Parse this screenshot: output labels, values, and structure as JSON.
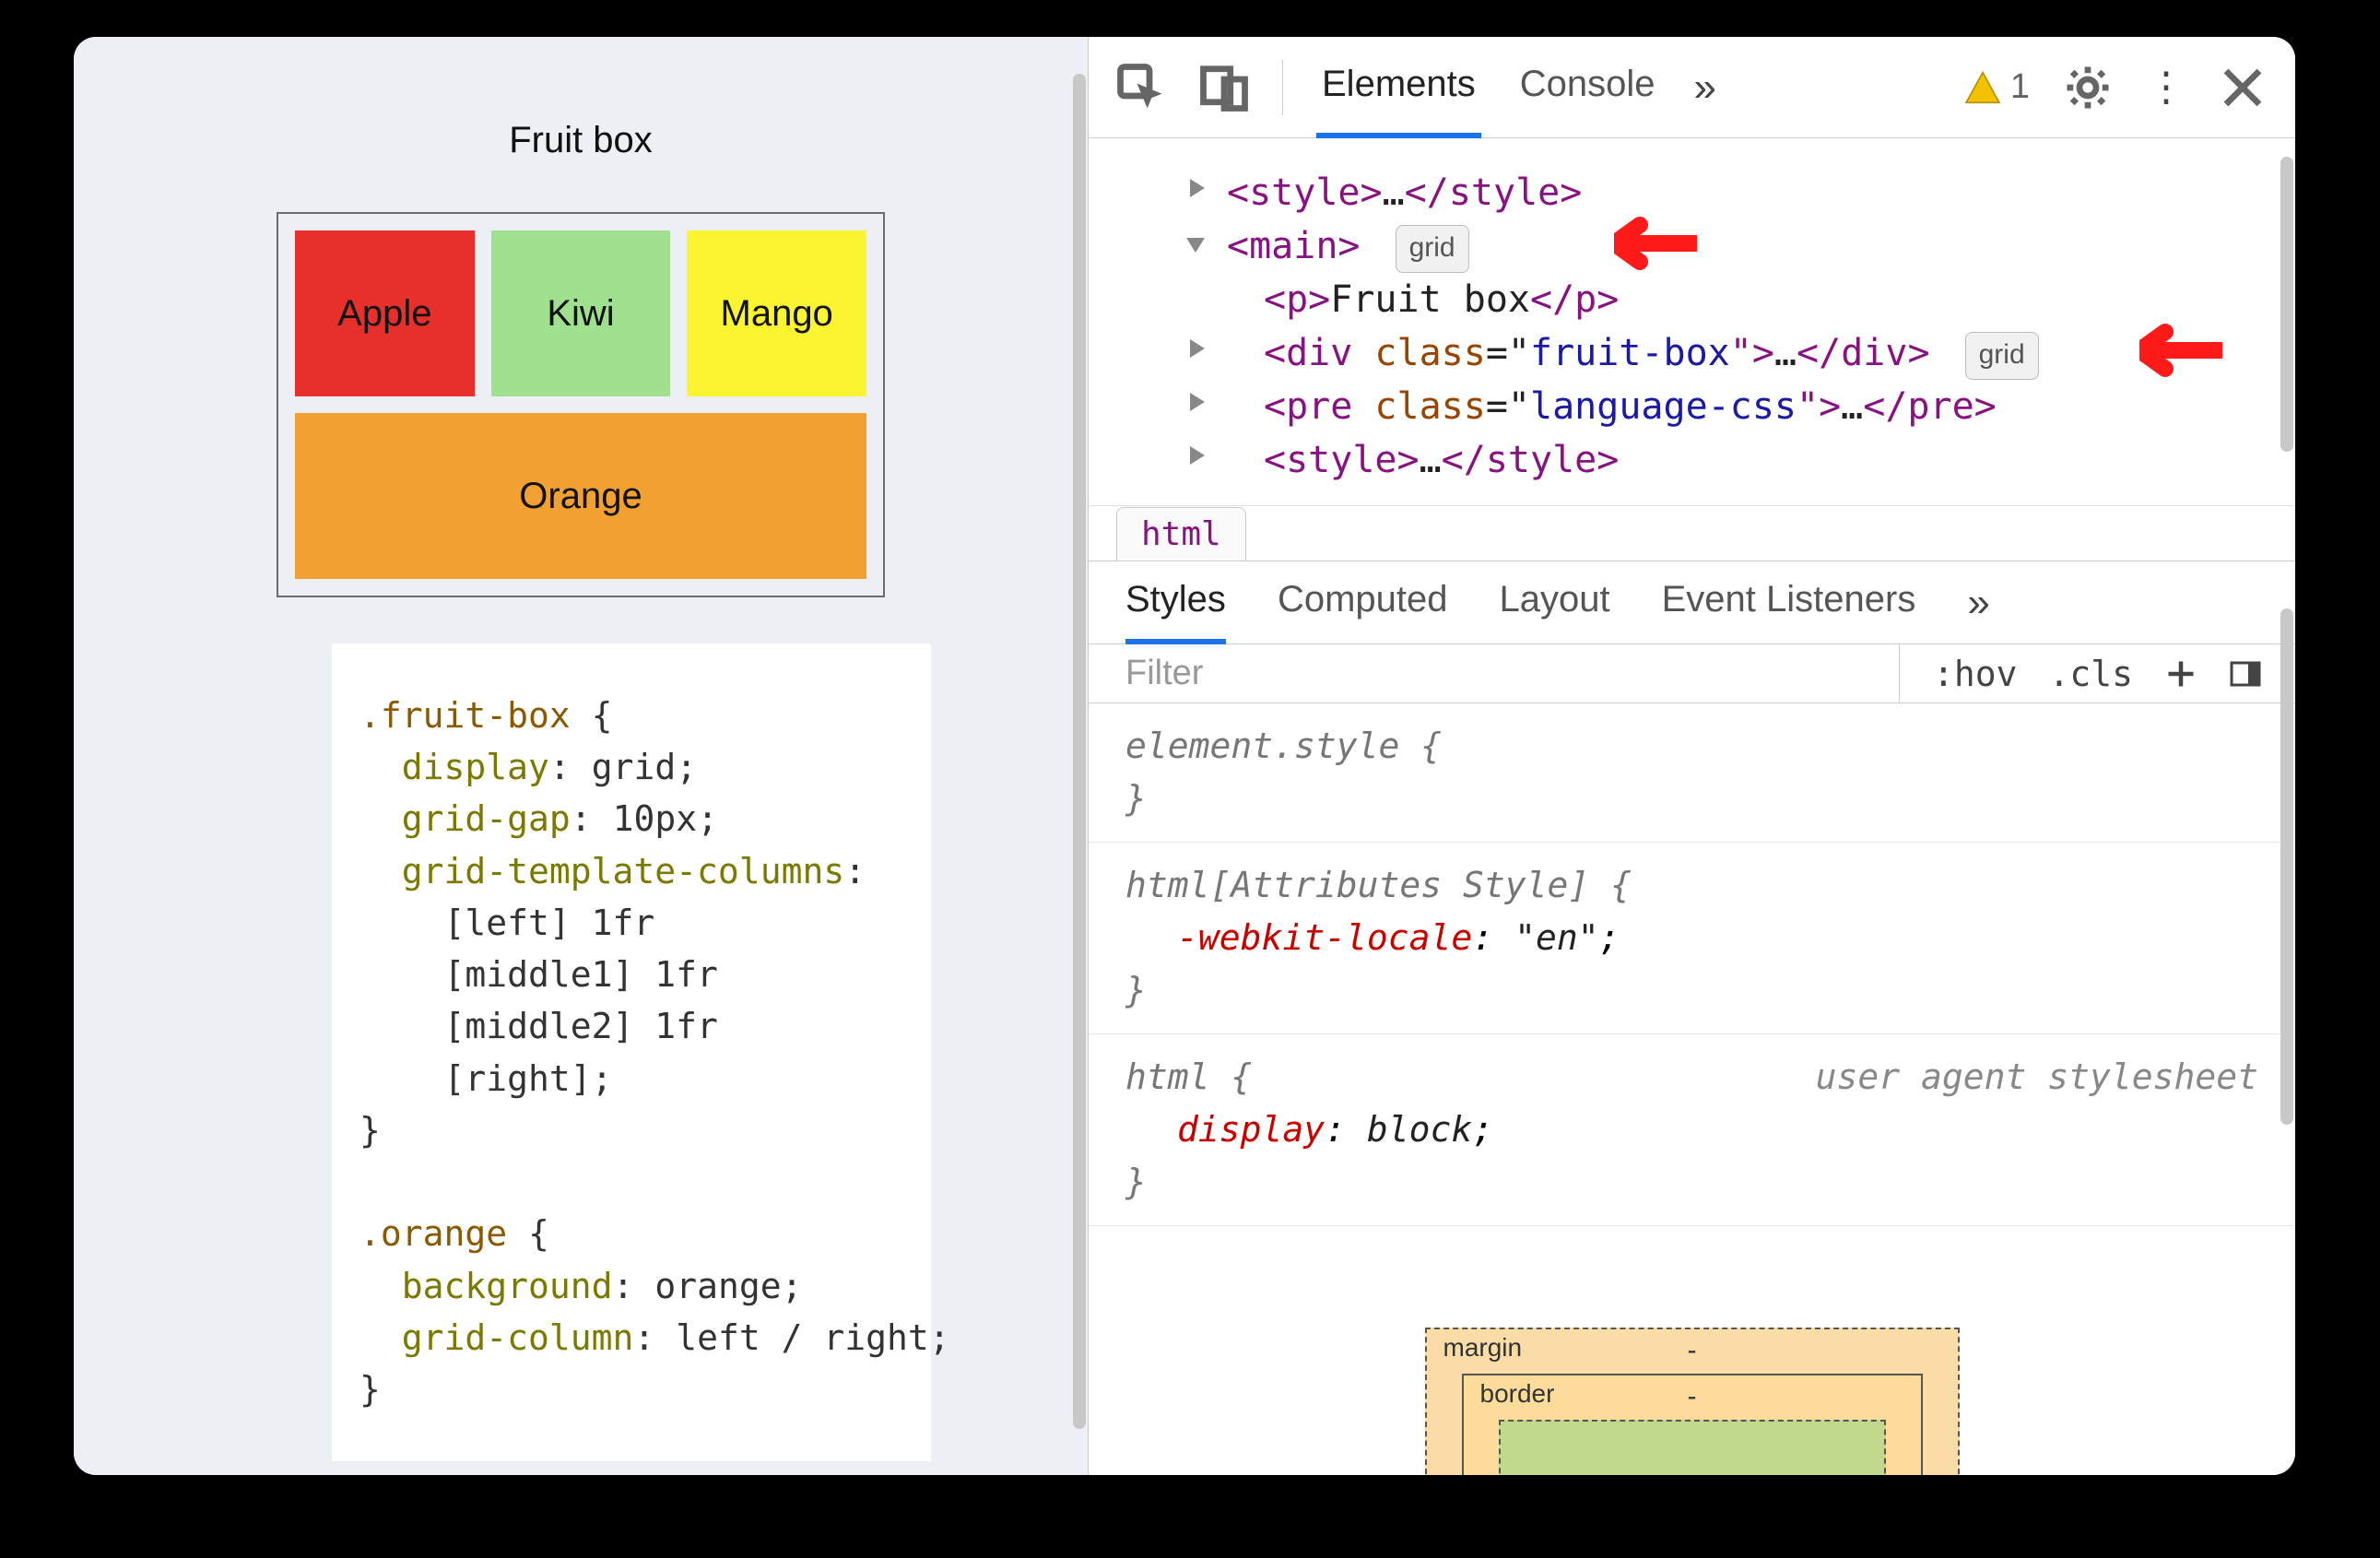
{
  "page": {
    "title": "Fruit box",
    "cells": {
      "apple": "Apple",
      "kiwi": "Kiwi",
      "mango": "Mango",
      "orange": "Orange"
    },
    "code": {
      "sel1": ".fruit-box",
      "p1": "display",
      "v1": "grid",
      "p2": "grid-gap",
      "v2": "10px",
      "p3": "grid-template-columns",
      "line_a": "[left] 1fr",
      "line_b": "[middle1] 1fr",
      "line_c": "[middle2] 1fr",
      "line_d": "[right]",
      "sel2": ".orange",
      "p4": "background",
      "v4": "orange",
      "p5": "grid-column",
      "v5": "left / right"
    }
  },
  "devtools": {
    "tabs": {
      "elements": "Elements",
      "console": "Console"
    },
    "more_glyph": "»",
    "warning_count": "1",
    "dom": {
      "style_open": "<style>",
      "style_close": "</style>",
      "ellipsis": "…",
      "main_open": "<main>",
      "grid_badge": "grid",
      "p_open": "<p>",
      "p_text": "Fruit box",
      "p_close": "</p>",
      "div_open1": "<div ",
      "div_attr": "class",
      "div_eq": "=\"",
      "div_val": "fruit-box",
      "div_open2": "\">",
      "div_close": "</div>",
      "pre_open1": "<pre ",
      "pre_attr": "class",
      "pre_val": "language-css",
      "pre_open2": "\">",
      "pre_close": "</pre>"
    },
    "breadcrumb": "html",
    "subtabs": {
      "styles": "Styles",
      "computed": "Computed",
      "layout": "Layout",
      "listeners": "Event Listeners"
    },
    "filter_placeholder": "Filter",
    "tools": {
      "hov": ":hov",
      "cls": ".cls"
    },
    "rules": {
      "r1": "element.style {",
      "r1c": "}",
      "r2": "html[Attributes Style] {",
      "r2p": "-webkit-locale",
      "r2v": "\"en\"",
      "r2c": "}",
      "r3": "html {",
      "ua": "user agent stylesheet",
      "r3p": "display",
      "r3v": "block",
      "r3c": "}"
    },
    "box_model": {
      "margin": "margin",
      "border": "border",
      "dash": "-"
    }
  }
}
